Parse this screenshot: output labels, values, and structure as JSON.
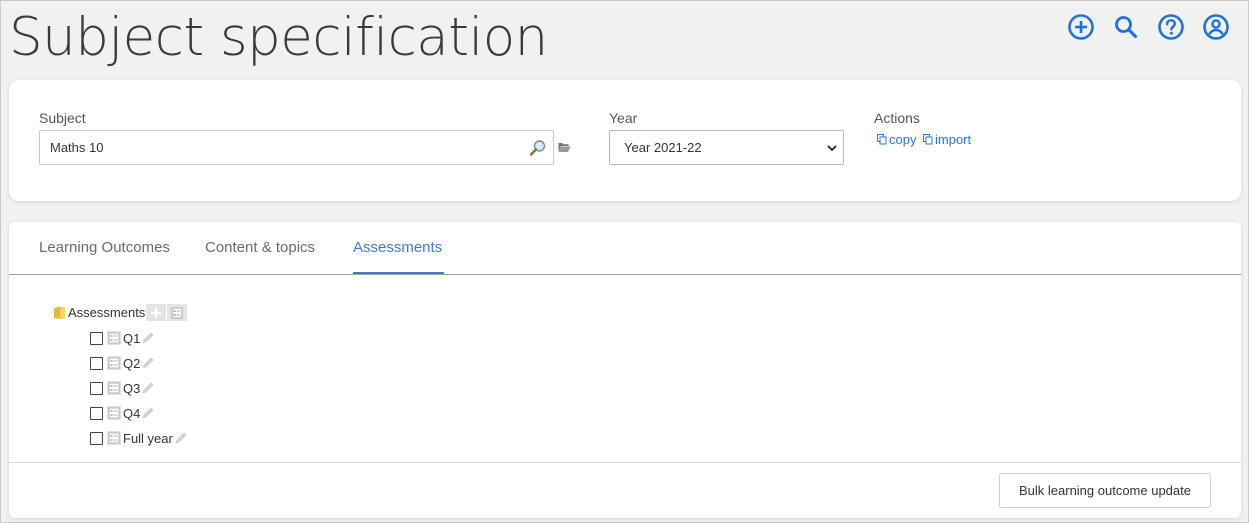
{
  "page": {
    "title": "Subject specification"
  },
  "top_icons": [
    {
      "name": "add-circle-icon"
    },
    {
      "name": "search-icon"
    },
    {
      "name": "help-circle-icon"
    },
    {
      "name": "account-circle-icon"
    }
  ],
  "filters": {
    "subject_label": "Subject",
    "subject_value": "Maths 10",
    "year_label": "Year",
    "year_value": "Year 2021-22",
    "actions_label": "Actions",
    "copy_label": "copy",
    "import_label": "import"
  },
  "tabs": [
    {
      "label": "Learning Outcomes",
      "active": false
    },
    {
      "label": "Content & topics",
      "active": false
    },
    {
      "label": "Assessments",
      "active": true
    }
  ],
  "tree": {
    "root_label": "Assessments",
    "items": [
      {
        "label": "Q1"
      },
      {
        "label": "Q2"
      },
      {
        "label": "Q3"
      },
      {
        "label": "Q4"
      },
      {
        "label": "Full year"
      }
    ]
  },
  "footer": {
    "bulk_button_label": "Bulk learning outcome update"
  },
  "colors": {
    "accent": "#2e74cc",
    "tab_active": "#3e7ccc",
    "background": "#f1f1f1"
  }
}
